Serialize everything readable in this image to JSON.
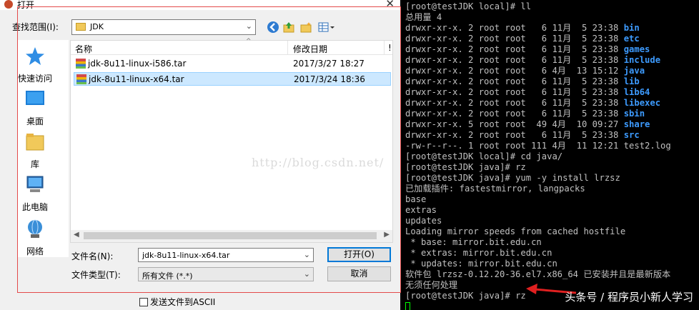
{
  "dialog": {
    "title": "打开",
    "close_glyph": "✕",
    "look_in_label": "查找范围(I):",
    "look_in_value": "JDK",
    "places": [
      {
        "label": "快速访问",
        "icon": "star-icon"
      },
      {
        "label": "桌面",
        "icon": "desktop-icon"
      },
      {
        "label": "库",
        "icon": "library-folder-icon"
      },
      {
        "label": "此电脑",
        "icon": "computer-icon"
      },
      {
        "label": "网络",
        "icon": "network-icon"
      }
    ],
    "columns": {
      "name": "名称",
      "modified": "修改日期",
      "extra": "!"
    },
    "files": [
      {
        "name": "jdk-8u11-linux-i586.tar",
        "modified": "2017/3/27 18:27",
        "selected": false
      },
      {
        "name": "jdk-8u11-linux-x64.tar",
        "modified": "2017/3/24 18:36",
        "selected": true
      }
    ],
    "file_name_label": "文件名(N):",
    "file_name_value": "jdk-8u11-linux-x64.tar",
    "file_type_label": "文件类型(T):",
    "file_type_value": "所有文件 (*.*)",
    "open_button": "打开(O)",
    "cancel_button": "取消",
    "ascii_checkbox_label": "发送文件到ASCII",
    "watermark": "http://blog.csdn.net/"
  },
  "terminal": {
    "lines": [
      {
        "text": "[root@testJDK local]# ll"
      },
      {
        "text": "总用量 4"
      },
      {
        "text": "drwxr-xr-x. 2 root root   6 11月  5 23:38 ",
        "dir": "bin"
      },
      {
        "text": "drwxr-xr-x. 2 root root   6 11月  5 23:38 ",
        "dir": "etc"
      },
      {
        "text": "drwxr-xr-x. 2 root root   6 11月  5 23:38 ",
        "dir": "games"
      },
      {
        "text": "drwxr-xr-x. 2 root root   6 11月  5 23:38 ",
        "dir": "include"
      },
      {
        "text": "drwxr-xr-x. 2 root root   6 4月  13 15:12 ",
        "dir": "java"
      },
      {
        "text": "drwxr-xr-x. 2 root root   6 11月  5 23:38 ",
        "dir": "lib"
      },
      {
        "text": "drwxr-xr-x. 2 root root   6 11月  5 23:38 ",
        "dir": "lib64"
      },
      {
        "text": "drwxr-xr-x. 2 root root   6 11月  5 23:38 ",
        "dir": "libexec"
      },
      {
        "text": "drwxr-xr-x. 2 root root   6 11月  5 23:38 ",
        "dir": "sbin"
      },
      {
        "text": "drwxr-xr-x. 5 root root  49 4月  10 09:27 ",
        "dir": "share"
      },
      {
        "text": "drwxr-xr-x. 2 root root   6 11月  5 23:38 ",
        "dir": "src"
      },
      {
        "text": "-rw-r--r--. 1 root root 111 4月  11 12:21 test2.log"
      },
      {
        "text": "[root@testJDK local]# cd java/"
      },
      {
        "text": "[root@testJDK java]# rz"
      },
      {
        "text": "[root@testJDK java]# yum -y install lrzsz"
      },
      {
        "text": "已加载插件: fastestmirror, langpacks"
      },
      {
        "text": "base"
      },
      {
        "text": "extras"
      },
      {
        "text": "updates"
      },
      {
        "text": "Loading mirror speeds from cached hostfile"
      },
      {
        "text": " * base: mirror.bit.edu.cn"
      },
      {
        "text": " * extras: mirror.bit.edu.cn"
      },
      {
        "text": " * updates: mirror.bit.edu.cn"
      },
      {
        "text": "软件包 lrzsz-0.12.20-36.el7.x86_64 已安装并且是最新版本"
      },
      {
        "text": "无须任何处理"
      },
      {
        "text": "[root@testJDK java]# rz"
      }
    ],
    "corner_watermark": "头条号 / 程序员小新人学习",
    "dir_color": "#3d9bff",
    "cursor_color": "#00ff00",
    "arrow_color": "#e02020"
  }
}
